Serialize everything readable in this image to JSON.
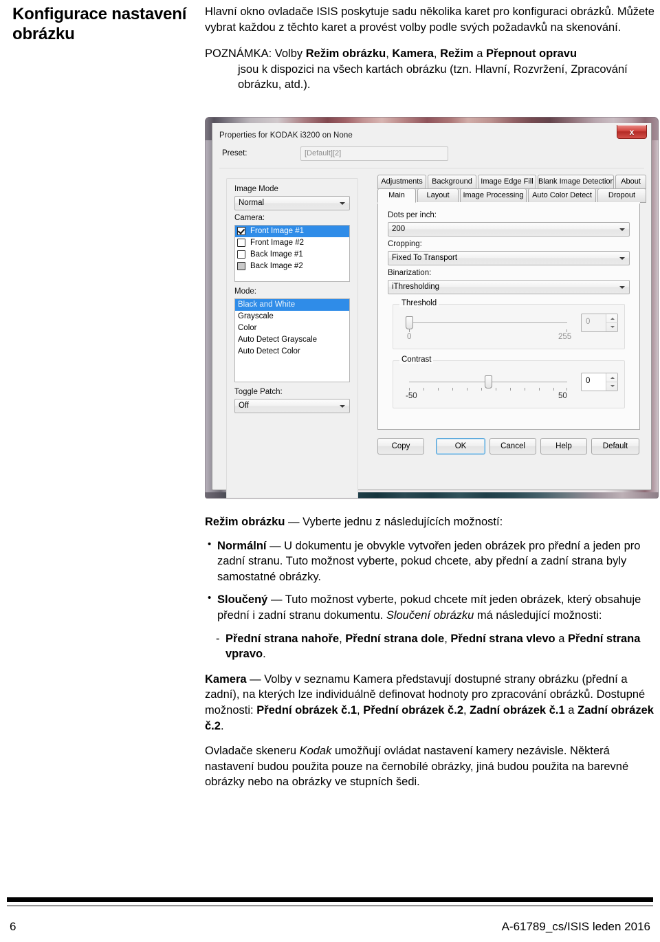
{
  "side_heading": "Konfigurace nastavení obrázku",
  "intro": {
    "p1": "Hlavní okno ovladače ISIS poskytuje sadu několika karet pro konfiguraci obrázků. Můžete vybrat každou z těchto karet a provést volby podle svých požadavků na skenování.",
    "note_label": "POZNÁMKA:",
    "note_lead": "Volby ",
    "note_b1": "Režim obrázku",
    "note_s1": ", ",
    "note_b2": "Kamera",
    "note_s2": ", ",
    "note_b3": "Režim",
    "note_s3": " a ",
    "note_b4": "Přepnout opravu",
    "note_tail": "jsou k dispozici na všech kartách obrázku (tzn. Hlavní, Rozvržení, Zpracování obrázku, atd.)."
  },
  "dialog": {
    "title": "Properties for KODAK i3200 on None",
    "close_label": "x",
    "preset_label": "Preset:",
    "preset_value": "[Default][2]",
    "image_mode_label": "Image Mode",
    "image_mode_value": "Normal",
    "camera_label": "Camera:",
    "camera_items": [
      {
        "label": "Front Image #1",
        "checked": true,
        "disabled": false,
        "selected": true
      },
      {
        "label": "Front Image #2",
        "checked": false,
        "disabled": false,
        "selected": false
      },
      {
        "label": "Back Image #1",
        "checked": false,
        "disabled": false,
        "selected": false
      },
      {
        "label": "Back Image #2",
        "checked": false,
        "disabled": true,
        "selected": false
      }
    ],
    "mode_label": "Mode:",
    "mode_items": [
      {
        "label": "Black and White",
        "selected": true
      },
      {
        "label": "Grayscale",
        "selected": false
      },
      {
        "label": "Color",
        "selected": false
      },
      {
        "label": "Auto Detect Grayscale",
        "selected": false
      },
      {
        "label": "Auto Detect Color",
        "selected": false
      }
    ],
    "toggle_patch_label": "Toggle Patch:",
    "toggle_patch_value": "Off",
    "tabs_row1": [
      "Adjustments",
      "Background",
      "Image Edge Fill",
      "Blank Image Detection",
      "About"
    ],
    "tabs_row2": [
      "Main",
      "Layout",
      "Image Processing",
      "Auto Color Detect",
      "Dropout"
    ],
    "active_tab": "Main",
    "dpi_label": "Dots per inch:",
    "dpi_value": "200",
    "cropping_label": "Cropping:",
    "cropping_value": "Fixed To Transport",
    "binarization_label": "Binarization:",
    "binarization_value": "iThresholding",
    "threshold_label": "Threshold",
    "threshold_value": "0",
    "threshold_min": "0",
    "threshold_max": "255",
    "contrast_label": "Contrast",
    "contrast_value": "0",
    "contrast_min": "-50",
    "contrast_max": "50",
    "buttons": [
      "Copy",
      "OK",
      "Cancel",
      "Help",
      "Default"
    ],
    "default_button": "OK"
  },
  "body": {
    "mode_head_b": "Režim obrázku",
    "mode_head_t": " — Vyberte jednu z následujících možností:",
    "b1_b": "Normální",
    "b1_t": " — U dokumentu je obvykle vytvořen jeden obrázek pro přední a jeden pro zadní stranu. Tuto možnost vyberte, pokud chcete, aby přední a zadní strana byly samostatné obrázky.",
    "b2_b": "Sloučený",
    "b2_t1": " — Tuto možnost vyberte, pokud chcete mít jeden obrázek, který obsahuje přední i zadní stranu dokumentu. ",
    "b2_i": "Sloučení obrázku",
    "b2_t2": " má následující možnosti:",
    "d1_b1": "Přední strana nahoře",
    "d1_s1": ", ",
    "d1_b2": "Přední strana dole",
    "d1_s2": ", ",
    "d1_b3": "Přední strana vlevo",
    "d1_s3": " a ",
    "d1_b4": "Přední strana vpravo",
    "d1_s4": ".",
    "cam_b": "Kamera",
    "cam_t1": " — Volby v seznamu Kamera představují dostupné strany obrázku (přední a zadní), na kterých lze individuálně definovat hodnoty pro zpracování obrázků. Dostupné možnosti: ",
    "cam_b1": "Přední obrázek č.1",
    "cam_s1": ", ",
    "cam_b2": "Přední obrázek č.2",
    "cam_s2": ", ",
    "cam_b3": "Zadní obrázek č.1",
    "cam_s3": " a  ",
    "cam_b4": "Zadní obrázek č.2",
    "cam_s4": ".",
    "last_t1": "Ovladače skeneru ",
    "last_i": "Kodak",
    "last_t2": " umožňují ovládat nastavení kamery nezávisle. Některá nastavení budou použita pouze na černobílé obrázky, jiná budou použita na barevné obrázky nebo na obrázky ve stupních šedi."
  },
  "footer": {
    "page_number": "6",
    "doc_ref": "A-61789_cs/ISIS leden 2016"
  }
}
